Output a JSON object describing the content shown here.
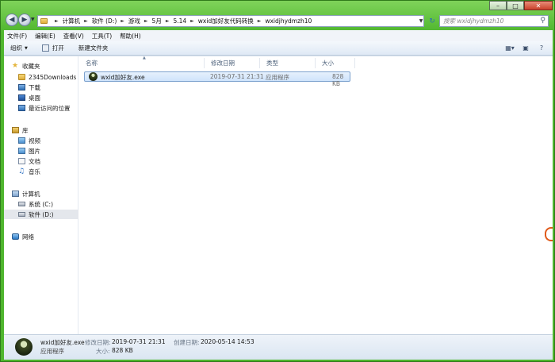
{
  "address": {
    "crumbs": [
      "计算机",
      "软件 (D:)",
      "游戏",
      "5月",
      "5.14",
      "wxid加好友代码转换",
      "wxidjhydmzh10"
    ]
  },
  "search": {
    "placeholder": "搜索 wxidjhydmzh10"
  },
  "menu": [
    "文件(F)",
    "编辑(E)",
    "查看(V)",
    "工具(T)",
    "帮助(H)"
  ],
  "toolbar": {
    "organize": "组织",
    "open": "打开",
    "new_folder": "新建文件夹"
  },
  "nav": {
    "favorites": "收藏夹",
    "fav_items": [
      "2345Downloads",
      "下载",
      "桌面",
      "最近访问的位置"
    ],
    "libraries": "库",
    "lib_items": [
      "视频",
      "图片",
      "文档",
      "音乐"
    ],
    "computer": "计算机",
    "drives": [
      "系统 (C:)",
      "软件 (D:)"
    ],
    "network": "网络"
  },
  "columns": {
    "name": "名称",
    "modified": "修改日期",
    "type": "类型",
    "size": "大小"
  },
  "files": [
    {
      "name": "wxid加好友.exe",
      "modified": "2019-07-31 21:31",
      "type": "应用程序",
      "size": "828 KB"
    }
  ],
  "details": {
    "filename": "wxid加好友.exe",
    "type": "应用程序",
    "modified_label": "修改日期:",
    "modified": "2019-07-31 21:31",
    "created_label": "创建日期:",
    "created": "2020-05-14 14:53",
    "size_label": "大小:",
    "size": "828 KB"
  },
  "colors": {
    "aero_glass": "#4fb62e",
    "selection": "#cfe3fb",
    "accent_blue": "#2a6db5"
  }
}
